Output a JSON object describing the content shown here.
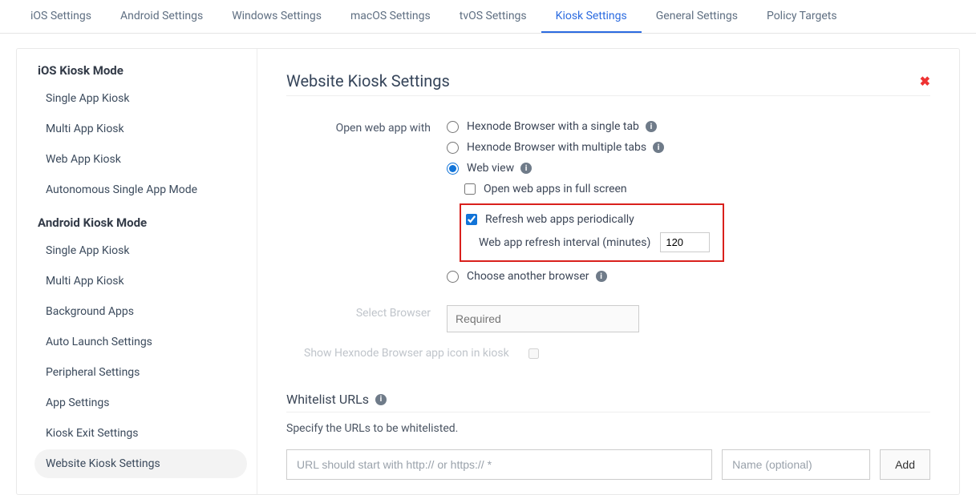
{
  "tabs": [
    {
      "label": "iOS Settings"
    },
    {
      "label": "Android Settings"
    },
    {
      "label": "Windows Settings"
    },
    {
      "label": "macOS Settings"
    },
    {
      "label": "tvOS Settings"
    },
    {
      "label": "Kiosk Settings"
    },
    {
      "label": "General Settings"
    },
    {
      "label": "Policy Targets"
    }
  ],
  "sidebar": {
    "groupA": {
      "title": "iOS Kiosk Mode",
      "items": [
        {
          "label": "Single App Kiosk"
        },
        {
          "label": "Multi App Kiosk"
        },
        {
          "label": "Web App Kiosk"
        },
        {
          "label": "Autonomous Single App Mode"
        }
      ]
    },
    "groupB": {
      "title": "Android Kiosk Mode",
      "items": [
        {
          "label": "Single App Kiosk"
        },
        {
          "label": "Multi App Kiosk"
        },
        {
          "label": "Background Apps"
        },
        {
          "label": "Auto Launch Settings"
        },
        {
          "label": "Peripheral Settings"
        },
        {
          "label": "App Settings"
        },
        {
          "label": "Kiosk Exit Settings"
        },
        {
          "label": "Website Kiosk Settings"
        }
      ]
    }
  },
  "main": {
    "title": "Website Kiosk Settings",
    "openWebAppWith": {
      "label": "Open web app with",
      "options": {
        "singleTab": "Hexnode Browser with a single tab",
        "multiTab": "Hexnode Browser with multiple tabs",
        "webView": "Web view"
      },
      "sub": {
        "fullscreen": "Open web apps in full screen",
        "refresh": "Refresh web apps periodically",
        "intervalLabel": "Web app refresh interval (minutes)",
        "intervalValue": "120"
      },
      "another": "Choose another browser"
    },
    "selectBrowser": {
      "label": "Select Browser",
      "placeholder": "Required"
    },
    "showBrowserIcon": {
      "label": "Show Hexnode Browser app icon in kiosk"
    },
    "whitelist": {
      "title": "Whitelist URLs",
      "hint": "Specify the URLs to be whitelisted.",
      "urlPlaceholder": "URL should start with http:// or https:// *",
      "namePlaceholder": "Name (optional)",
      "addLabel": "Add"
    }
  }
}
